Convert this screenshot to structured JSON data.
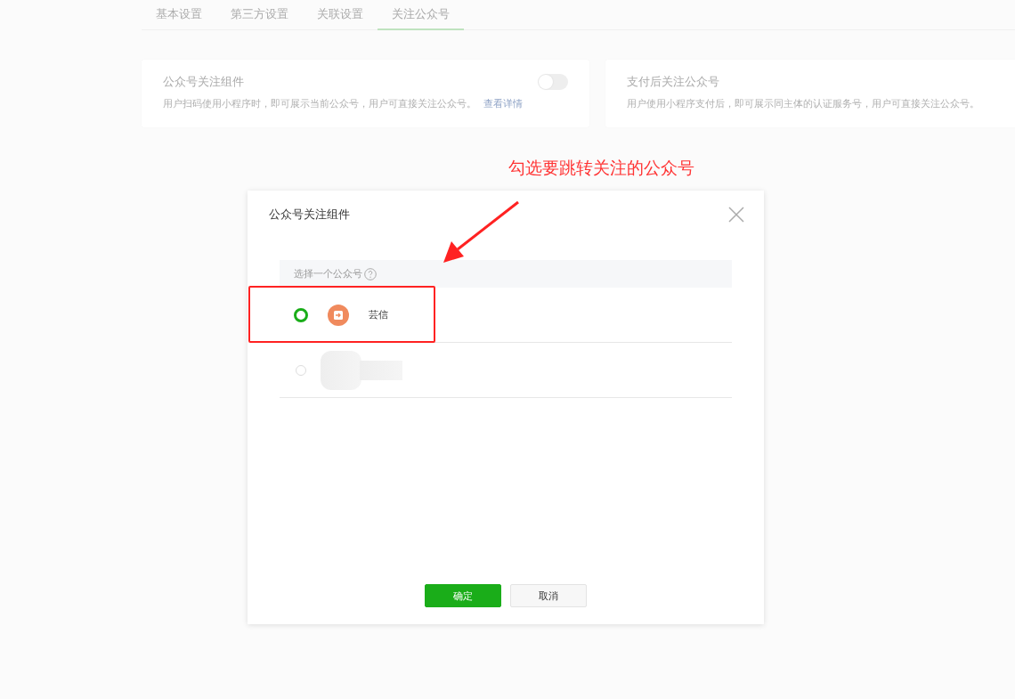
{
  "tabs": [
    {
      "label": "基本设置",
      "selected": false
    },
    {
      "label": "第三方设置",
      "selected": false
    },
    {
      "label": "关联设置",
      "selected": false
    },
    {
      "label": "关注公众号",
      "selected": true
    }
  ],
  "cards": [
    {
      "title": "公众号关注组件",
      "description": "用户扫码使用小程序时，即可展示当前公众号，用户可直接关注公众号。",
      "link": "查看详情",
      "toggle": {
        "on": false
      }
    },
    {
      "title": "支付后关注公众号",
      "description": "用户使用小程序支付后，即可展示同主体的认证服务号，用户可直接关注公众号。"
    }
  ],
  "dialog": {
    "title": "公众号关注组件",
    "list_header": "选择一个公众号",
    "accounts": [
      {
        "kind": "visible",
        "name": "芸信",
        "selected": true
      },
      {
        "kind": "blurred",
        "selected": false
      }
    ],
    "buttons": [
      {
        "kind": "primary",
        "label": "确定"
      },
      {
        "kind": "default",
        "label": "取消"
      }
    ]
  },
  "annotation": {
    "text": "勾选要跳转关注的公众号"
  }
}
